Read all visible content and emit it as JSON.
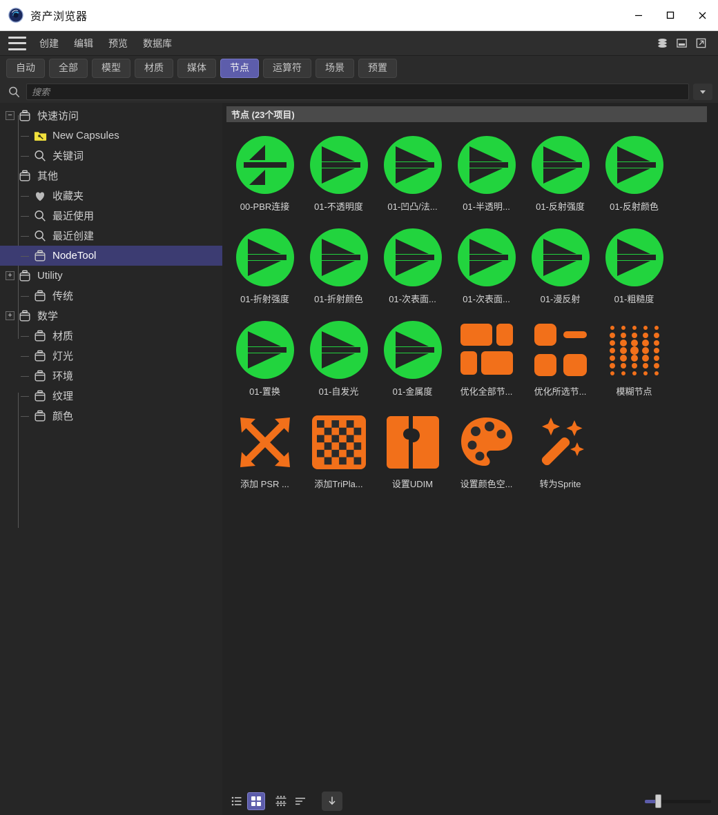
{
  "window": {
    "title": "资产浏览器",
    "logo_icon": "asset-browser-logo-icon",
    "minimize_label": "—",
    "maximize_label": "□",
    "close_label": "✕"
  },
  "menubar": {
    "hamburger_icon": "hamburger-menu-icon",
    "items": [
      {
        "label": "创建",
        "name": "menu-create"
      },
      {
        "label": "编辑",
        "name": "menu-edit"
      },
      {
        "label": "预览",
        "name": "menu-preview"
      },
      {
        "label": "数据库",
        "name": "menu-database"
      }
    ],
    "right_icons": [
      {
        "name": "database-icon"
      },
      {
        "name": "panel-icon"
      },
      {
        "name": "external-link-icon"
      }
    ]
  },
  "tabs": {
    "active": "节点",
    "items": [
      {
        "label": "自动",
        "active": false
      },
      {
        "label": "全部",
        "active": false
      },
      {
        "label": "模型",
        "active": false
      },
      {
        "label": "材质",
        "active": false
      },
      {
        "label": "媒体",
        "active": false
      },
      {
        "label": "节点",
        "active": true
      },
      {
        "label": "运算符",
        "active": false
      },
      {
        "label": "场景",
        "active": false
      },
      {
        "label": "预置",
        "active": false
      }
    ],
    "active_color": "#5d5dab"
  },
  "search": {
    "placeholder": "搜索",
    "value": "",
    "icon": "search-icon",
    "dropdown_icon": "chevron-down-icon"
  },
  "sidebar": {
    "items": [
      {
        "label": "快速访问",
        "icon": "capsule-icon",
        "depth": 0,
        "expander": "−",
        "selected": false
      },
      {
        "label": "New Capsules",
        "icon": "folder-key-icon",
        "depth": 1,
        "expander": "",
        "selected": false
      },
      {
        "label": "关键词",
        "icon": "magnifier-icon",
        "depth": 1,
        "expander": "",
        "selected": false
      },
      {
        "label": "其他",
        "icon": "capsule-icon",
        "depth": 1,
        "expander": "+",
        "selected": false
      },
      {
        "label": "收藏夹",
        "icon": "heart-icon",
        "depth": 1,
        "expander": "",
        "selected": false
      },
      {
        "label": "最近使用",
        "icon": "magnifier-icon",
        "depth": 1,
        "expander": "",
        "selected": false
      },
      {
        "label": "最近创建",
        "icon": "magnifier-icon",
        "depth": 1,
        "expander": "",
        "selected": false
      },
      {
        "label": "NodeTool",
        "icon": "capsule-icon",
        "depth": 1,
        "expander": "",
        "selected": true
      },
      {
        "label": "Utility",
        "icon": "capsule-icon",
        "depth": 0,
        "expander": "+",
        "selected": false
      },
      {
        "label": "传统",
        "icon": "capsule-icon",
        "depth": 1,
        "expander": "",
        "selected": false
      },
      {
        "label": "数学",
        "icon": "capsule-icon",
        "depth": 0,
        "expander": "+",
        "selected": false
      },
      {
        "label": "材质",
        "icon": "capsule-icon",
        "depth": 1,
        "expander": "",
        "selected": false
      },
      {
        "label": "灯光",
        "icon": "capsule-icon",
        "depth": 1,
        "expander": "",
        "selected": false
      },
      {
        "label": "环境",
        "icon": "capsule-icon",
        "depth": 1,
        "expander": "",
        "selected": false
      },
      {
        "label": "纹理",
        "icon": "capsule-icon",
        "depth": 1,
        "expander": "",
        "selected": false
      },
      {
        "label": "颜色",
        "icon": "capsule-icon",
        "depth": 1,
        "expander": "",
        "selected": false
      }
    ],
    "selected_color": "#3c3c72"
  },
  "content": {
    "header": "节点 (23个项目)",
    "item_count": 23,
    "green_color": "#22d43e",
    "orange_color": "#f2701a",
    "items": [
      {
        "label": "00-PBR连接",
        "icon": "node-split-icon",
        "color": "green"
      },
      {
        "label": "01-不透明度",
        "icon": "node-arrow-icon",
        "color": "green"
      },
      {
        "label": "01-凹凸/法...",
        "icon": "node-arrow-icon",
        "color": "green"
      },
      {
        "label": "01-半透明...",
        "icon": "node-arrow-icon",
        "color": "green"
      },
      {
        "label": "01-反射强度",
        "icon": "node-arrow-icon",
        "color": "green"
      },
      {
        "label": "01-反射颜色",
        "icon": "node-arrow-icon",
        "color": "green"
      },
      {
        "label": "01-折射强度",
        "icon": "node-arrow-icon",
        "color": "green"
      },
      {
        "label": "01-折射颜色",
        "icon": "node-arrow-icon",
        "color": "green"
      },
      {
        "label": "01-次表面...",
        "icon": "node-arrow-icon",
        "color": "green"
      },
      {
        "label": "01-次表面...",
        "icon": "node-arrow-icon",
        "color": "green"
      },
      {
        "label": "01-漫反射",
        "icon": "node-arrow-icon",
        "color": "green"
      },
      {
        "label": "01-粗糙度",
        "icon": "node-arrow-icon",
        "color": "green"
      },
      {
        "label": "01-置换",
        "icon": "node-arrow-icon",
        "color": "green"
      },
      {
        "label": "01-自发光",
        "icon": "node-arrow-icon",
        "color": "green"
      },
      {
        "label": "01-金属度",
        "icon": "node-arrow-icon",
        "color": "green"
      },
      {
        "label": "优化全部节...",
        "icon": "layout-blocks-icon",
        "color": "orange"
      },
      {
        "label": "优化所选节...",
        "icon": "selected-blocks-icon",
        "color": "orange"
      },
      {
        "label": "模糊节点",
        "icon": "dot-grid-icon",
        "color": "orange"
      },
      {
        "label": "添加 PSR ...",
        "icon": "four-arrows-icon",
        "color": "orange"
      },
      {
        "label": "添加TriPla...",
        "icon": "checkerboard-icon",
        "color": "orange"
      },
      {
        "label": "设置UDIM",
        "icon": "puzzle-piece-icon",
        "color": "orange"
      },
      {
        "label": "设置颜色空...",
        "icon": "palette-icon",
        "color": "orange"
      },
      {
        "label": "转为Sprite",
        "icon": "magic-wand-icon",
        "color": "orange"
      }
    ]
  },
  "bottombar": {
    "view_buttons": [
      {
        "name": "list-view-button",
        "icon": "list-view-icon",
        "active": false
      },
      {
        "name": "grid-view-button",
        "icon": "grid-view-icon",
        "active": true
      },
      {
        "name": "detail-view-button",
        "icon": "detail-grid-icon",
        "active": false
      },
      {
        "name": "sort-button",
        "icon": "sort-icon",
        "active": false
      }
    ],
    "download_icon": "download-arrow-icon",
    "zoom_slider": {
      "value": 20,
      "min": 0,
      "max": 100
    }
  }
}
